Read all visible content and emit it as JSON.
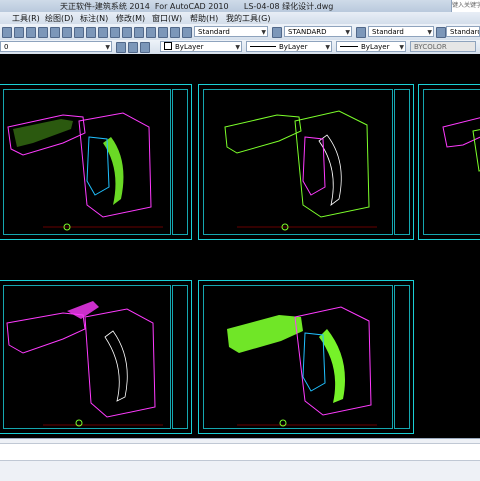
{
  "window": {
    "title": "天正软件-建筑系统 2014  For AutoCAD 2010      LS-04-08 绿化设计.dwg"
  },
  "search": {
    "placeholder": "键入关键字或短语"
  },
  "menu": [
    {
      "label": "工具(R)"
    },
    {
      "label": "绘图(D)"
    },
    {
      "label": "标注(N)"
    },
    {
      "label": "修改(M)"
    },
    {
      "label": "窗口(W)"
    },
    {
      "label": "帮助(H)"
    },
    {
      "label": "我的工具(G)"
    }
  ],
  "toolbar": {
    "text_style": "Standard",
    "dim_style": "STANDARD",
    "table_style": "Standard",
    "ml_style": "Standard"
  },
  "properties": {
    "layer": "0",
    "color": "ByLayer",
    "linetype": "ByLayer",
    "lineweight": "ByLayer",
    "plotstyle": "BYCOLOR"
  },
  "colors": {
    "cad_background": "#000000",
    "frame": "#1bd0d6",
    "highlight": "#7cff2b",
    "magenta": "#ff3bff"
  }
}
